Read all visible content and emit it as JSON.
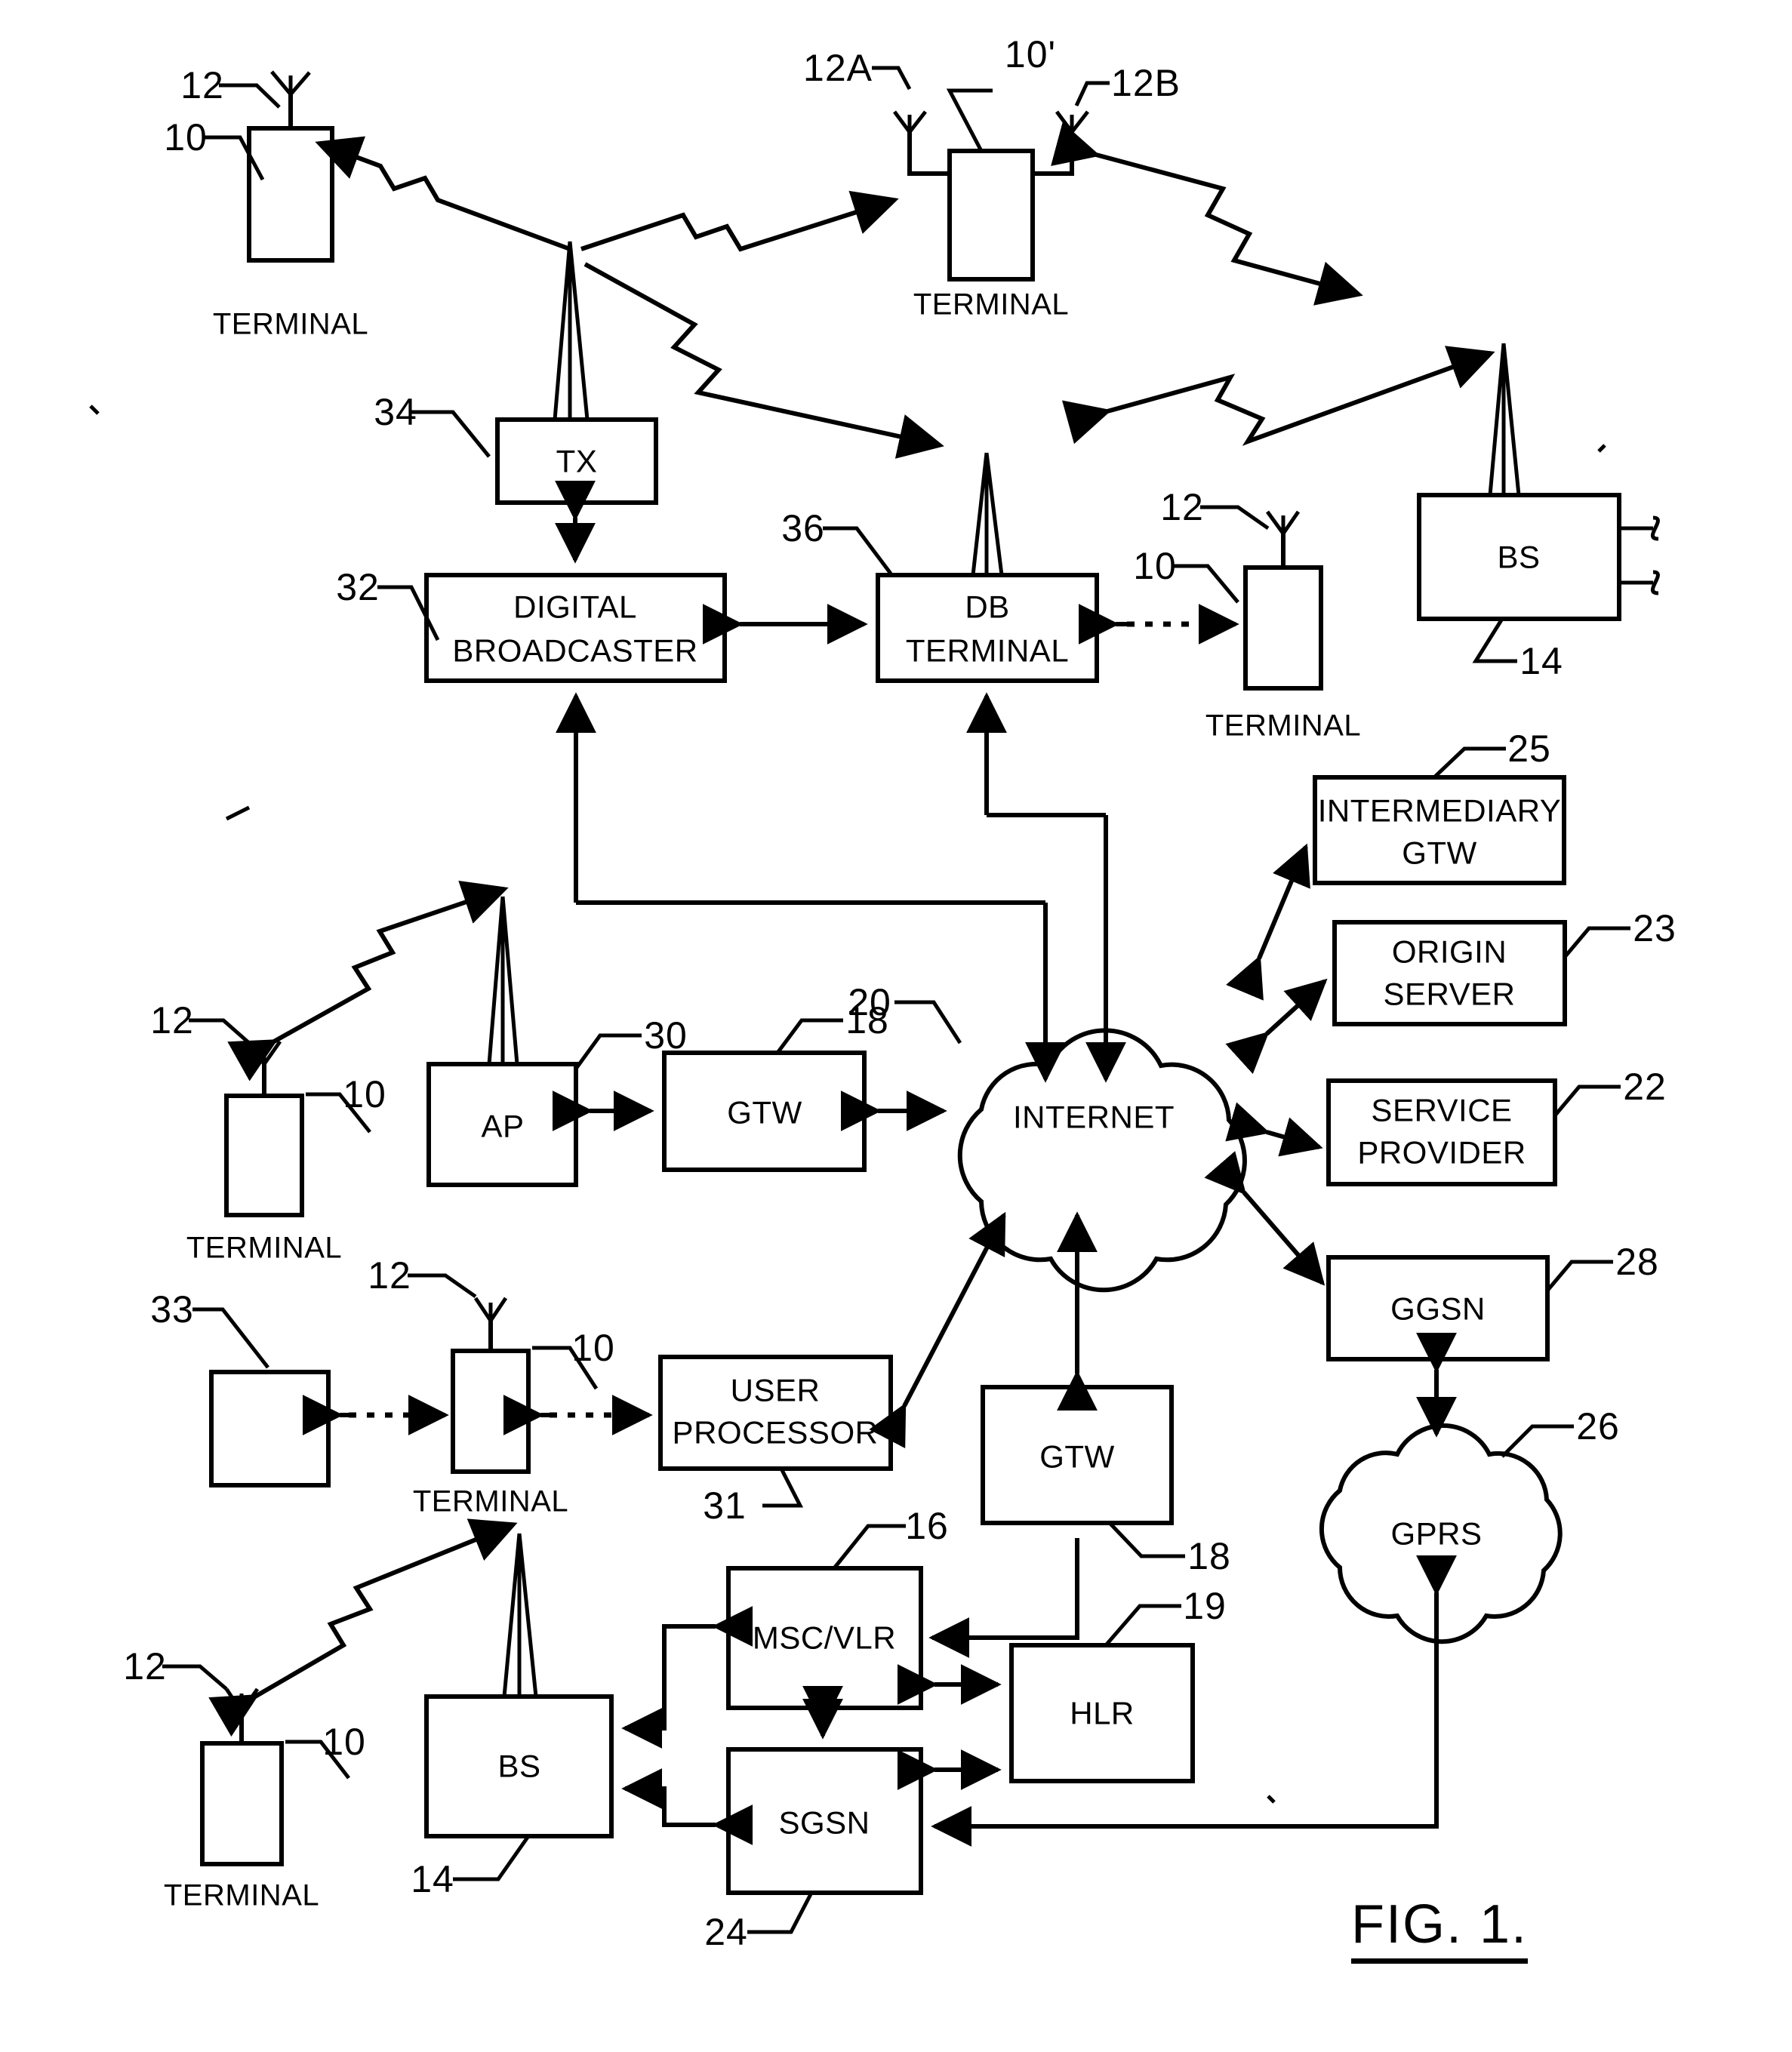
{
  "figure": {
    "caption": "FIG. 1.",
    "type": "patent-block-diagram"
  },
  "nodes": {
    "terminal_top_left": {
      "label": "TERMINAL",
      "ref_device": "10",
      "ref_antenna": "12"
    },
    "terminal_top_center": {
      "label": "TERMINAL",
      "ref_device": "10'",
      "ref_antenna_a": "12A",
      "ref_antenna_b": "12B"
    },
    "tx": {
      "label": "TX",
      "ref": "34"
    },
    "digital_broadcaster": {
      "label_line1": "DIGITAL",
      "label_line2": "BROADCASTER",
      "ref": "32"
    },
    "db_terminal": {
      "label_line1": "DB",
      "label_line2": "TERMINAL",
      "ref": "36"
    },
    "terminal_mid_right": {
      "label": "TERMINAL",
      "ref_device": "10",
      "ref_antenna": "12"
    },
    "base_station_top": {
      "label": "BS",
      "ref": "14"
    },
    "intermediary_gtw": {
      "label_line1": "INTERMEDIARY",
      "label_line2": "GTW",
      "ref": "25"
    },
    "origin_server": {
      "label_line1": "ORIGIN",
      "label_line2": "SERVER",
      "ref": "23"
    },
    "service_provider": {
      "label_line1": "SERVICE",
      "label_line2": "PROVIDER",
      "ref": "22"
    },
    "ggsn": {
      "label": "GGSN",
      "ref": "28"
    },
    "gprs": {
      "label": "GPRS",
      "ref": "26"
    },
    "internet": {
      "label": "INTERNET",
      "ref": "20"
    },
    "terminal_ap_left": {
      "label": "TERMINAL",
      "ref_device": "10",
      "ref_antenna": "12"
    },
    "access_point": {
      "label": "AP",
      "ref": "30"
    },
    "gtw_upper": {
      "label": "GTW",
      "ref": "18"
    },
    "gtw_lower": {
      "label": "GTW",
      "ref": "18"
    },
    "peripheral_33": {
      "label": "",
      "ref": "33"
    },
    "terminal_user": {
      "label": "TERMINAL",
      "ref_device": "10",
      "ref_antenna": "12"
    },
    "user_processor": {
      "label_line1": "USER",
      "label_line2": "PROCESSOR",
      "ref": "31"
    },
    "msc_vlr": {
      "label": "MSC/VLR",
      "ref": "16"
    },
    "hlr": {
      "label": "HLR",
      "ref": "19"
    },
    "sgsn": {
      "label": "SGSN",
      "ref": "24"
    },
    "base_station_bottom": {
      "label": "BS",
      "ref": "14"
    },
    "terminal_bottom_left": {
      "label": "TERMINAL",
      "ref_device": "10",
      "ref_antenna": "12"
    }
  },
  "colors": {
    "line": "#000000",
    "background": "#ffffff"
  }
}
